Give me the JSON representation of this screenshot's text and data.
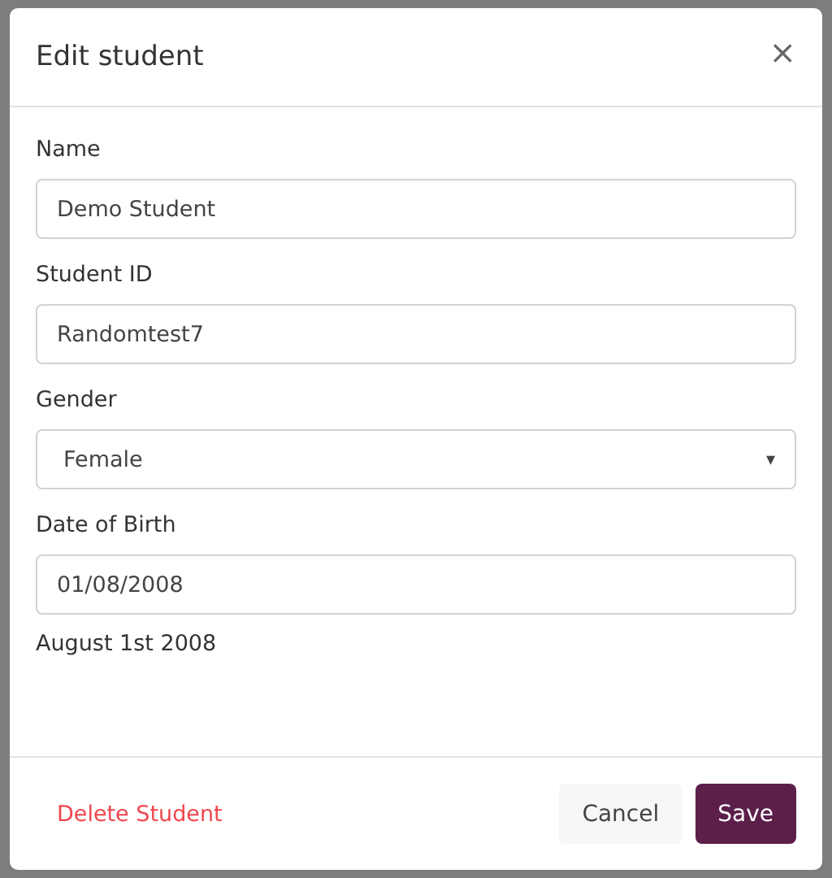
{
  "modal": {
    "title": "Edit student",
    "close": "×",
    "fields": [
      {
        "kind": "text",
        "label": "Name",
        "value": "Demo Student"
      },
      {
        "kind": "text",
        "label": "Student ID",
        "value": "Randomtest7"
      },
      {
        "kind": "select",
        "label": "Gender",
        "value": "Female",
        "caret": "▾"
      },
      {
        "kind": "date",
        "label": "Date of Birth",
        "value": "01/08/2008",
        "hint": "August 1st 2008"
      }
    ],
    "footer": {
      "delete": "Delete Student",
      "buttons": [
        {
          "kind": "secondary",
          "label": "Cancel"
        },
        {
          "kind": "primary",
          "label": "Save"
        }
      ]
    }
  }
}
